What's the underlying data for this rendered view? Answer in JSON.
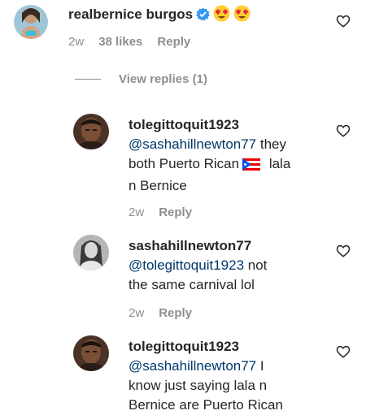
{
  "comments": [
    {
      "username": "realbernice burgos",
      "emojis": [
        "heart-eyes-emoji",
        "heart-eyes-emoji"
      ],
      "time": "2w",
      "likes": "38 likes",
      "reply": "Reply"
    },
    {
      "username": "tolegittoquit1923",
      "mention": "@sashahillnewton77",
      "text1": " they",
      "text2": "both Puerto Rican",
      "text2b": " lala",
      "text3": "n Bernice",
      "time": "2w",
      "reply": "Reply"
    },
    {
      "username": "sashahillnewton77",
      "mention": "@tolegittoquit1923",
      "text1": " not",
      "text2": "the same carnival lol",
      "time": "2w",
      "reply": "Reply"
    },
    {
      "username": "tolegittoquit1923",
      "mention": "@sashahillnewton77",
      "text1": " I",
      "text2": "know just saying lala n",
      "text3": "Bernice are Puerto Rican"
    }
  ],
  "view_replies": "View replies (1)",
  "colors": {
    "text": "#262626",
    "meta": "#8e8e8e",
    "mention": "#00376b",
    "verified": "#3897f0"
  }
}
